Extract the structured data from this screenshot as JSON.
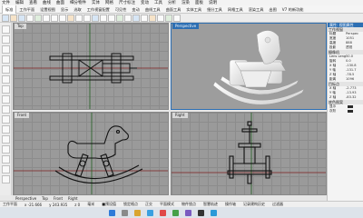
{
  "menu": [
    "文件",
    "编辑",
    "查看",
    "曲线",
    "曲面",
    "细分物件",
    "实体",
    "网格",
    "尺寸标注",
    "变动",
    "工具",
    "分析",
    "渲染",
    "面板",
    "说明"
  ],
  "tabs": [
    "标准",
    "工作平面",
    "设置视图",
    "显示",
    "选取",
    "工作视窗配置",
    "可见性",
    "变动",
    "曲线工具",
    "曲面工具",
    "实体工具",
    "细分工具",
    "网格工具",
    "渲染工具",
    "出图",
    "V7 的新功能"
  ],
  "viewports": {
    "top": "Top",
    "perspective": "Perspective",
    "front": "Front",
    "right": "Right"
  },
  "viewport_tabs": [
    "Perspective",
    "Top",
    "Front",
    "Right"
  ],
  "status": {
    "workplane": "工作平面",
    "x": "x -21.666",
    "y": "y 243.935",
    "z": "z 0",
    "units": "毫米",
    "layer": "■预设值",
    "snaps": [
      "锁定格点",
      "正交",
      "平面模式",
      "物件锁点",
      "智慧轨迹",
      "操作轴",
      "记录建构历史",
      "过滤器"
    ]
  },
  "panel": {
    "title": "属性: 视图属性",
    "sections": [
      {
        "header": "工作视窗",
        "rows": [
          [
            "标题",
            "Perspec"
          ],
          [
            "宽度",
            "1051"
          ],
          [
            "高度",
            "888"
          ],
          [
            "投影",
            "透视"
          ]
        ]
      },
      {
        "header": "摄像机",
        "rows": [
          [
            "Lens Length",
            "50.0"
          ],
          [
            "旋转",
            "0.0"
          ],
          [
            "X 轴",
            "-130.8"
          ],
          [
            "Y 轴",
            "-131.7"
          ],
          [
            "Z 轴",
            "-78.5"
          ],
          [
            "距离",
            "1096"
          ]
        ]
      },
      {
        "header": "目标点",
        "rows": [
          [
            "X 轴",
            "-2.773"
          ],
          [
            "Y 轴",
            "-13.93"
          ],
          [
            "Z 轴",
            "-83.32"
          ]
        ]
      },
      {
        "header": "底色图案",
        "rows": [
          [
            "显示",
            ""
          ],
          [
            "灰阶",
            ""
          ]
        ]
      }
    ],
    "accent": "#2d6fb3"
  },
  "colors": {
    "viewport": "#9a9a9a",
    "active_title": "#2d6fb3",
    "model": "#f2f2f2"
  }
}
